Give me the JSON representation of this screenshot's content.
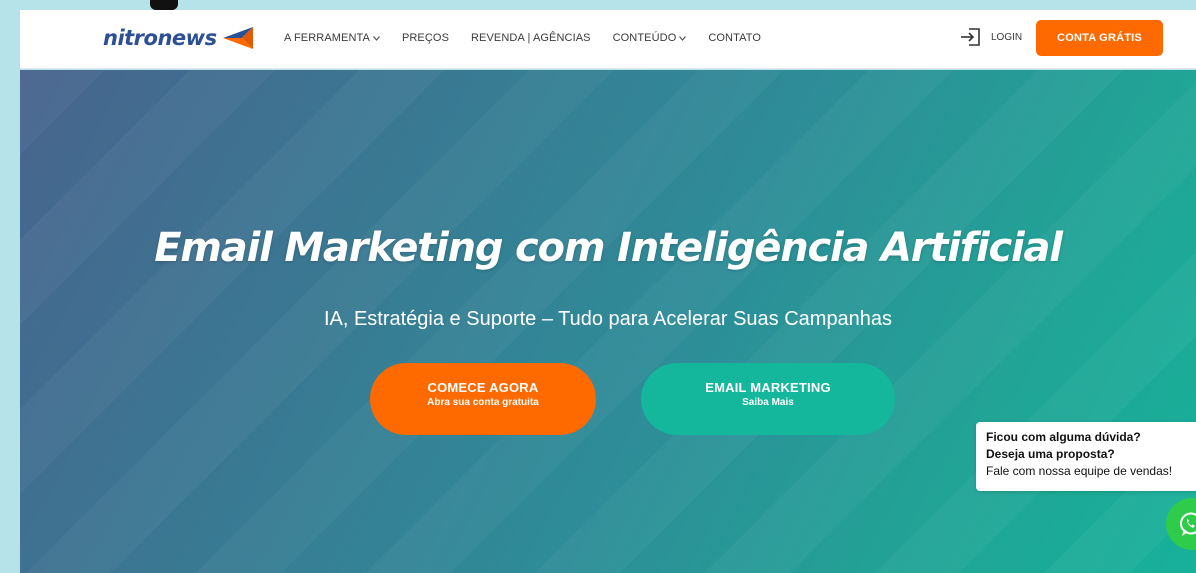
{
  "brand": {
    "name": "nitronews",
    "color": "#2d4f93",
    "accent": "#fe6a00"
  },
  "nav": {
    "items": [
      {
        "label": "A FERRAMENTA",
        "dropdown": true
      },
      {
        "label": "PREÇOS",
        "dropdown": false
      },
      {
        "label": "REVENDA | AGÊNCIAS",
        "dropdown": false
      },
      {
        "label": "CONTEÚDO",
        "dropdown": true
      },
      {
        "label": "CONTATO",
        "dropdown": false
      }
    ],
    "login_label": "LOGIN",
    "cta_label": "CONTA GRÁTIS"
  },
  "hero": {
    "title": "Email Marketing com Inteligência Artificial",
    "subtitle": "IA, Estratégia e Suporte – Tudo para Acelerar Suas Campanhas",
    "primary_button": {
      "label": "COMECE AGORA",
      "sublabel": "Abra sua conta gratuita",
      "color": "#fe6a00"
    },
    "secondary_button": {
      "label": "EMAIL MARKETING",
      "sublabel": "Saiba Mais",
      "color": "#14b79b"
    }
  },
  "chat": {
    "line1": "Ficou com alguma dúvida?",
    "line2": "Deseja uma proposta?",
    "line3": "Fale com nossa equipe de vendas!",
    "icon": "whatsapp-icon",
    "color": "#2ecc4a"
  }
}
